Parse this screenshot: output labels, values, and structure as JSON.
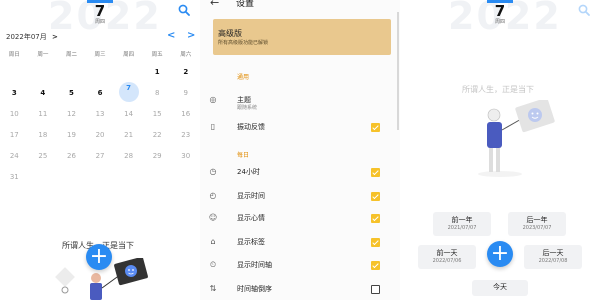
{
  "colors": {
    "accent": "#2a8bf2",
    "premium": "#e9c88e",
    "section": "#e08a00",
    "checkbox": "#f6c22a"
  },
  "calendar": {
    "big_year": "2022",
    "date_chip": {
      "day": "7",
      "weekday": "周四"
    },
    "month_label": "2022年07月",
    "month_arrow": ">",
    "prev": "<",
    "next": ">",
    "weekdays": [
      "周日",
      "周一",
      "周二",
      "周三",
      "周四",
      "周五",
      "周六"
    ],
    "weeks": [
      [
        "",
        "",
        "",
        "",
        "",
        "1",
        "2"
      ],
      [
        "3",
        "4",
        "5",
        "6",
        "7",
        "8",
        "9"
      ],
      [
        "10",
        "11",
        "12",
        "13",
        "14",
        "15",
        "16"
      ],
      [
        "17",
        "18",
        "19",
        "20",
        "21",
        "22",
        "23"
      ],
      [
        "24",
        "25",
        "26",
        "27",
        "28",
        "29",
        "30"
      ],
      [
        "31",
        "",
        "",
        "",
        "",
        "",
        ""
      ]
    ],
    "today": "7",
    "motto": "所谓人生，正是当下",
    "fab": "+",
    "search_icon": "search-icon"
  },
  "settings": {
    "back": "←",
    "title": "设置",
    "premium": {
      "title": "高级版",
      "subtitle": "所有高级版功能已解锁"
    },
    "section_general": "通用",
    "section_daily": "每日",
    "rows": [
      {
        "icon": "palette-icon",
        "glyph": "◎",
        "label": "主题",
        "sub": "跟随系统",
        "check": null
      },
      {
        "icon": "vibration-icon",
        "glyph": "▯",
        "label": "振动反馈",
        "sub": "",
        "check": true
      },
      {
        "icon": "clock-icon",
        "glyph": "◷",
        "label": "24小时",
        "sub": "",
        "check": true
      },
      {
        "icon": "time-icon",
        "glyph": "◴",
        "label": "显示时间",
        "sub": "",
        "check": true
      },
      {
        "icon": "mood-icon",
        "glyph": "☺",
        "label": "显示心情",
        "sub": "",
        "check": true
      },
      {
        "icon": "tag-icon",
        "glyph": "⌂",
        "label": "显示标签",
        "sub": "",
        "check": true
      },
      {
        "icon": "timeline-icon",
        "glyph": "⏲",
        "label": "显示时间轴",
        "sub": "",
        "check": true
      },
      {
        "icon": "sort-icon",
        "glyph": "⇅",
        "label": "时间轴倒序",
        "sub": "",
        "check": false
      }
    ]
  },
  "navigator": {
    "big_year": "2022",
    "date_chip": {
      "day": "7",
      "weekday": "周四"
    },
    "motto": "所谓人生，正是当下",
    "buttons": [
      {
        "label": "前一年",
        "date": "2021/07/07"
      },
      {
        "label": "后一年",
        "date": "2023/07/07"
      },
      {
        "label": "前一天",
        "date": "2022/07/06"
      },
      {
        "label": "后一天",
        "date": "2022/07/08"
      },
      {
        "label": "今天",
        "date": ""
      }
    ],
    "fab": "+"
  }
}
